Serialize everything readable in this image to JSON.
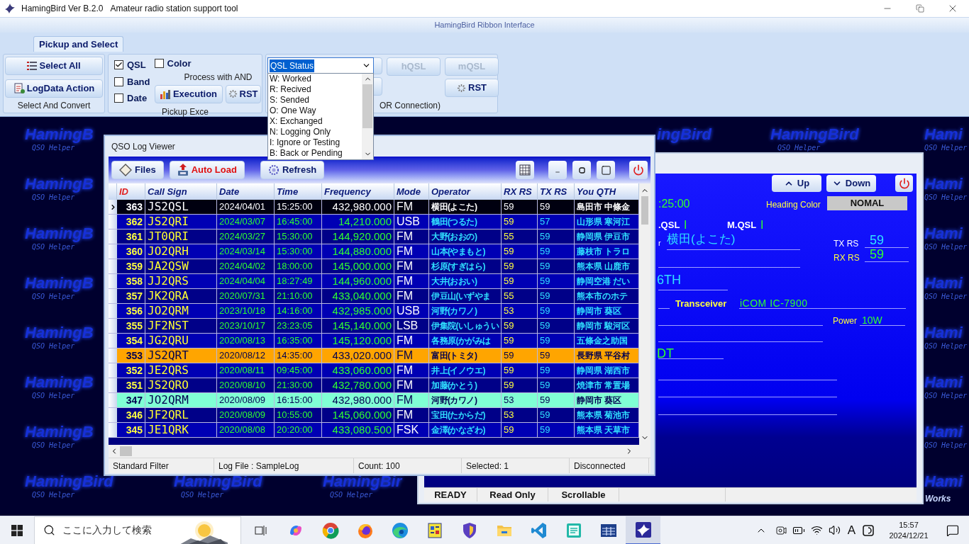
{
  "window": {
    "title": "HamingBird Ver B.2.0",
    "subtitle": "Amateur radio station support tool"
  },
  "ribbon": {
    "header": "HamingBird Ribbon Interface",
    "tabs": [
      {
        "label": "Pickup and Select",
        "selected": true
      }
    ],
    "group1": {
      "caption": "Select And Convert",
      "buttons": [
        {
          "label": "Select All",
          "kind": "list"
        },
        {
          "label": "LogData Action",
          "kind": "action"
        }
      ]
    },
    "group2": {
      "caption": "Pickup Exce",
      "checkboxes": [
        {
          "label": "QSL",
          "checked": true
        },
        {
          "label": "Band",
          "checked": false
        },
        {
          "label": "Date",
          "checked": false
        }
      ],
      "color_checkbox": {
        "label": "Color",
        "checked": false
      },
      "note": "Process with AND",
      "buttons": [
        {
          "label": "Execution",
          "kind": "chart"
        },
        {
          "label": "RST",
          "kind": "reset"
        }
      ]
    },
    "group3": {
      "caption": "OR Connection)",
      "combo": {
        "value": "QSL Status",
        "open": true,
        "options": [
          "W: Worked",
          "R: Recived",
          "S: Sended",
          "O: One Way",
          "X: Exchanged",
          "N: Logging Only",
          "I: Ignore or Testing",
          "B: Back or Pending"
        ]
      },
      "buttons": [
        {
          "label": "hQSL",
          "disabled": true
        },
        {
          "label": "mQSL",
          "disabled": true
        },
        {
          "label": "RST",
          "disabled": false
        }
      ]
    }
  },
  "wallpaper": {
    "left_column": [
      {
        "title": "HamingB",
        "subtitle": "QSO Helper"
      },
      {
        "title": "HamingB",
        "subtitle": "QSO Helper"
      },
      {
        "title": "HamingB",
        "subtitle": "QSO Helper"
      },
      {
        "title": "HamingB",
        "subtitle": "QSO Helper"
      },
      {
        "title": "HamingB",
        "subtitle": "QSO Helper"
      },
      {
        "title": "HamingB",
        "subtitle": "QSO Helper"
      },
      {
        "title": "HamingB",
        "subtitle": "QSO Helper"
      }
    ],
    "bottom_row": [
      {
        "title": "HamingBird",
        "subtitle": "QSO Helper"
      },
      {
        "title": "HamingBird",
        "subtitle": "QSO Helper"
      },
      {
        "title": "HamingBir",
        "subtitle": "QSO Helper"
      }
    ],
    "top_row": [
      {
        "title": "ingBird"
      },
      {
        "title": "HamingBird",
        "subtitle": "QSO Helper"
      }
    ],
    "right_column": [
      {
        "title": "Hami",
        "subtitle": "QSO Helper"
      },
      {
        "title": "Hami",
        "subtitle": "QSO Helper"
      },
      {
        "title": "Hami",
        "subtitle": "QSO Helper"
      },
      {
        "title": "Hami",
        "subtitle": "QSO Helper"
      },
      {
        "title": "Hami",
        "subtitle": "QSO Helper"
      },
      {
        "title": "Hami",
        "subtitle": "QSO Helper"
      },
      {
        "title": "Hami",
        "subtitle": "QSO Helper"
      },
      {
        "title": "Hami"
      }
    ],
    "footer": "Works"
  },
  "log_viewer": {
    "title": "QSO Log Viewer",
    "toolbar": [
      {
        "label": "Files",
        "kind": "files"
      },
      {
        "label": "Auto Load",
        "kind": "load"
      },
      {
        "label": "Refresh",
        "kind": "refresh"
      }
    ],
    "columns": [
      "ID",
      "Call Sign",
      "Date",
      "Time",
      "Frequency",
      "Mode",
      "Operator",
      "RX RS",
      "TX RS",
      "You QTH"
    ],
    "rows": [
      {
        "id": "363",
        "call": "JS2QSL",
        "date": "2024/04/01",
        "time": "15:25:00",
        "freq": "432,980.000",
        "mode": "FM",
        "operator": "横田(よこた)",
        "rx": "59",
        "tx": "59",
        "qth": "島田市 中條金",
        "selected": true
      },
      {
        "id": "362",
        "call": "JS2QRI",
        "date": "2024/03/07",
        "time": "16:45:00",
        "freq": "14,210.000",
        "mode": "USB",
        "operator": "鶴田(つるた)",
        "rx": "59",
        "tx": "57",
        "qth": "山形県 寒河江",
        "selected": false
      },
      {
        "id": "361",
        "call": "JT0QRI",
        "date": "2024/03/27",
        "time": "15:30:00",
        "freq": "144,920.000",
        "mode": "FM",
        "operator": "大野(おおの)",
        "rx": "55",
        "tx": "59",
        "qth": "静岡県 伊豆市",
        "selected": false
      },
      {
        "id": "360",
        "call": "JO2QRH",
        "date": "2024/03/14",
        "time": "15:30:00",
        "freq": "144,880.000",
        "mode": "FM",
        "operator": "山本(やまもと)",
        "rx": "59",
        "tx": "59",
        "qth": "藤枝市 トラロ",
        "selected": false
      },
      {
        "id": "359",
        "call": "JA2QSW",
        "date": "2024/04/02",
        "time": "18:00:00",
        "freq": "145,000.000",
        "mode": "FM",
        "operator": "杉原(すぎはら)",
        "rx": "59",
        "tx": "59",
        "qth": "熊本県 山鹿市",
        "selected": false
      },
      {
        "id": "358",
        "call": "JJ2QRS",
        "date": "2024/04/04",
        "time": "18:27:49",
        "freq": "144,960.000",
        "mode": "FM",
        "operator": "大井(おおい)",
        "rx": "59",
        "tx": "59",
        "qth": "静岡空港 だい",
        "selected": false
      },
      {
        "id": "357",
        "call": "JK2QRA",
        "date": "2020/07/31",
        "time": "21:10:00",
        "freq": "433,040.000",
        "mode": "FM",
        "operator": "伊豆山(いずやま",
        "rx": "55",
        "tx": "59",
        "qth": "熊本市のホテ",
        "selected": false
      },
      {
        "id": "356",
        "call": "JO2QRM",
        "date": "2023/10/18",
        "time": "14:16:00",
        "freq": "432,985.000",
        "mode": "USB",
        "operator": "河野(カワノ)",
        "rx": "53",
        "tx": "59",
        "qth": "静岡市 葵区",
        "selected": false
      },
      {
        "id": "355",
        "call": "JF2NST",
        "date": "2023/10/17",
        "time": "23:23:05",
        "freq": "145,140.000",
        "mode": "LSB",
        "operator": "伊集院(いしゅうい",
        "rx": "59",
        "tx": "59",
        "qth": "静岡市 駿河区",
        "selected": false
      },
      {
        "id": "354",
        "call": "JG2QRU",
        "date": "2020/08/13",
        "time": "16:35:00",
        "freq": "145,120.000",
        "mode": "FM",
        "operator": "各務原(かがみは",
        "rx": "59",
        "tx": "59",
        "qth": "五條金之助国",
        "selected": false
      },
      {
        "id": "353",
        "call": "JS2QRT",
        "date": "2020/08/12",
        "time": "14:35:00",
        "freq": "433,020.000",
        "mode": "FM",
        "operator": "富田(トミタ)",
        "rx": "59",
        "tx": "59",
        "qth": "長野県 平谷村",
        "selected": false,
        "color": "#ffa500"
      },
      {
        "id": "352",
        "call": "JE2QRS",
        "date": "2020/08/11",
        "time": "09:45:00",
        "freq": "433,060.000",
        "mode": "FM",
        "operator": "井上(イノウエ)",
        "rx": "59",
        "tx": "59",
        "qth": "静岡県 湖西市",
        "selected": false
      },
      {
        "id": "351",
        "call": "JS2QRO",
        "date": "2020/08/10",
        "time": "21:30:00",
        "freq": "432,780.000",
        "mode": "FM",
        "operator": "加藤(かとう)",
        "rx": "59",
        "tx": "59",
        "qth": "焼津市 常置場",
        "selected": false
      },
      {
        "id": "347",
        "call": "JO2QRM",
        "date": "2020/08/09",
        "time": "16:15:00",
        "freq": "432,980.000",
        "mode": "FM",
        "operator": "河野(カワノ)",
        "rx": "53",
        "tx": "59",
        "qth": "静岡市 葵区",
        "selected": false,
        "color": "#80ffd4"
      },
      {
        "id": "346",
        "call": "JF2QRL",
        "date": "2020/08/09",
        "time": "10:55:00",
        "freq": "145,060.000",
        "mode": "FM",
        "operator": "宝田(たからだ)",
        "rx": "53",
        "tx": "59",
        "qth": "熊本県 菊池市",
        "selected": false
      },
      {
        "id": "345",
        "call": "JE1QRK",
        "date": "2020/08/08",
        "time": "20:20:00",
        "freq": "433,080.500",
        "mode": "FSK",
        "operator": "金澤(かなざわ)",
        "rx": "59",
        "tx": "59",
        "qth": "熊本県 天草市",
        "selected": false
      }
    ],
    "status": [
      "Standard Filter",
      "Log File : SampleLog",
      "Count: 100",
      "Selected: 1",
      "Disconnected"
    ]
  },
  "detail": {
    "buttons": [
      "Up",
      "Down"
    ],
    "heading_color_label": "Heading Color",
    "heading_color_value": "NOMAL",
    "time": ":25:00",
    "qsl_label": ".QSL",
    "qsl_value": "I",
    "mqsl_label": "M.QSL",
    "mqsl_value": "I",
    "operator_label": "r",
    "operator": "横田(よこた)",
    "tx_rs_label": "TX RS",
    "tx_rs": "59",
    "rx_rs_label": "RX RS",
    "rx_rs": "59",
    "qth": "6TH",
    "transceiver_label": "Transceiver",
    "transceiver": "iCOM IC-7900",
    "power_label": "Power",
    "power": "10W",
    "mode": "DT",
    "status": [
      "READY",
      "Read Only",
      "Scrollable"
    ]
  },
  "taskbar": {
    "search_placeholder": "ここに入力して検索",
    "ime": "A",
    "time": "15:57",
    "date": "2024/12/21",
    "apps": [
      {
        "kind": "swirl",
        "selected": false
      },
      {
        "kind": "wheel",
        "selected": false
      },
      {
        "kind": "flame",
        "selected": false
      },
      {
        "kind": "wave",
        "selected": false
      },
      {
        "kind": "board",
        "selected": false
      },
      {
        "kind": "shield",
        "selected": false
      },
      {
        "kind": "folder",
        "selected": false
      },
      {
        "kind": "code",
        "selected": false
      },
      {
        "kind": "notes",
        "selected": false
      },
      {
        "kind": "table",
        "selected": false
      },
      {
        "kind": "bird",
        "selected": true
      }
    ]
  }
}
